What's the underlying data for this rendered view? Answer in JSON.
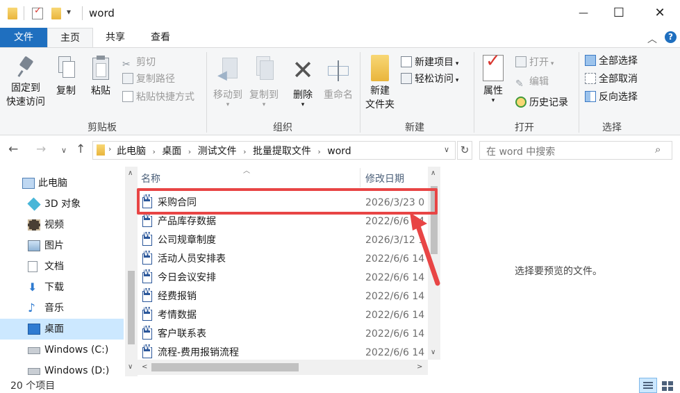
{
  "window": {
    "title": "word",
    "quick_access_caret": "▾",
    "minimize": "—",
    "maximize": "☐",
    "close": "✕"
  },
  "tabs": [
    "文件",
    "主页",
    "共享",
    "查看"
  ],
  "ribbon": {
    "clipboard": {
      "pin_line1": "固定到",
      "pin_line2": "快速访问",
      "copy": "复制",
      "paste": "粘贴",
      "cut": "剪切",
      "copy_path": "复制路径",
      "paste_shortcut": "粘贴快捷方式",
      "label": "剪贴板"
    },
    "organize": {
      "move_to": "移动到",
      "copy_to": "复制到",
      "delete": "删除",
      "rename": "重命名",
      "label": "组织"
    },
    "new": {
      "new_item": "新建项目",
      "easy_access": "轻松访问",
      "new_folder_line1": "新建",
      "new_folder_line2": "文件夹",
      "label": "新建"
    },
    "open": {
      "properties": "属性",
      "open": "打开",
      "edit": "编辑",
      "history": "历史记录",
      "label": "打开"
    },
    "select": {
      "select_all": "全部选择",
      "select_none": "全部取消",
      "invert": "反向选择",
      "label": "选择"
    }
  },
  "address": {
    "crumbs": [
      "此电脑",
      "桌面",
      "测试文件",
      "批量提取文件",
      "word"
    ],
    "search_placeholder": "在 word 中搜索"
  },
  "nav": {
    "items": [
      "此电脑",
      "3D 对象",
      "视频",
      "图片",
      "文档",
      "下载",
      "音乐",
      "桌面",
      "Windows (C:)",
      "Windows (D:)"
    ],
    "selected_index": 7
  },
  "list": {
    "col_name": "名称",
    "col_date": "修改日期",
    "files": [
      {
        "name": "采购合同",
        "date": "2026/3/23 0"
      },
      {
        "name": "产品库存数据",
        "date": "2022/6/6 14"
      },
      {
        "name": "公司规章制度",
        "date": "2026/3/12 1"
      },
      {
        "name": "活动人员安排表",
        "date": "2022/6/6 14"
      },
      {
        "name": "今日会议安排",
        "date": "2022/6/6 14"
      },
      {
        "name": "经费报销",
        "date": "2022/6/6 14"
      },
      {
        "name": "考情数据",
        "date": "2022/6/6 14"
      },
      {
        "name": "客户联系表",
        "date": "2022/6/6 14"
      },
      {
        "name": "流程-费用报销流程",
        "date": "2022/6/6 14"
      }
    ]
  },
  "preview": {
    "message": "选择要预览的文件。"
  },
  "status": {
    "count": "20 个项目"
  },
  "colors": {
    "accent": "#1f6fbf",
    "highlight": "#e84545",
    "selected": "#cce8ff"
  }
}
